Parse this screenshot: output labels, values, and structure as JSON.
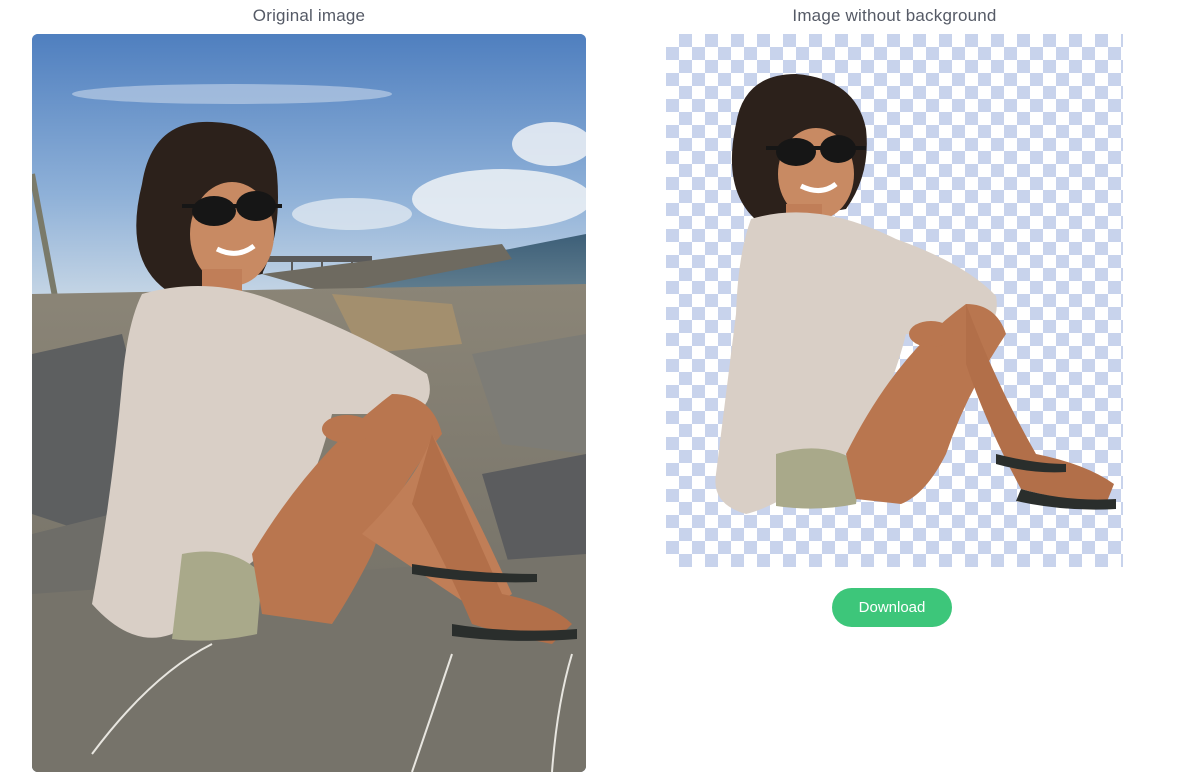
{
  "original_panel": {
    "caption": "Original image",
    "image_description_icon": "photo-icon"
  },
  "result_panel": {
    "caption": "Image without background",
    "transparency_pattern": "checkerboard"
  },
  "actions": {
    "download_label": "Download"
  },
  "colors": {
    "accent": "#3dc67a",
    "checker": "#c8d3ec",
    "caption_text": "#555a66"
  }
}
